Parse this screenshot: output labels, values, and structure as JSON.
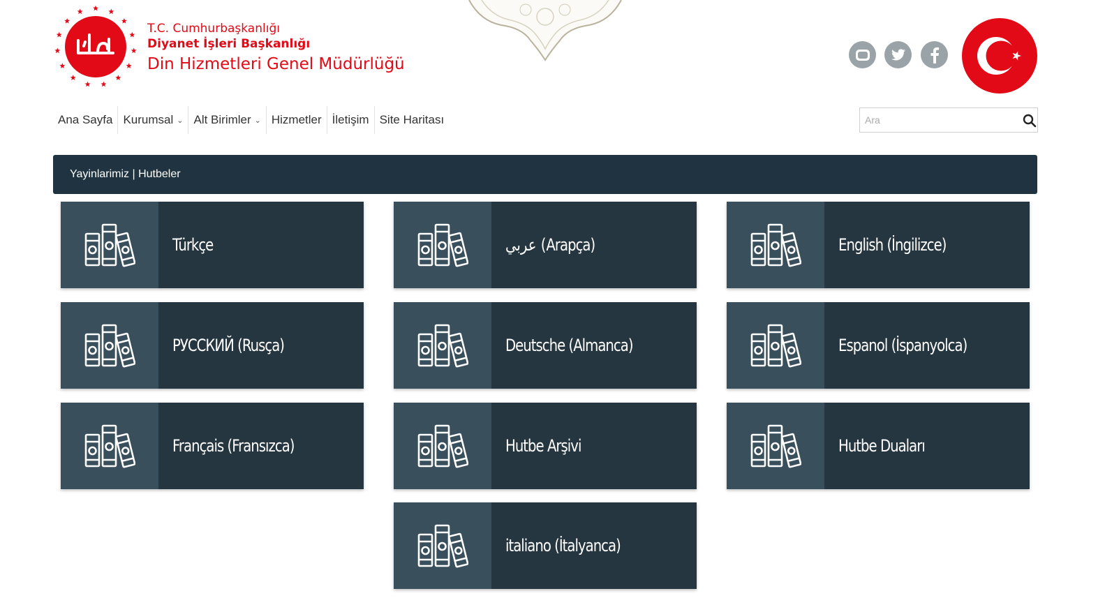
{
  "header": {
    "line1": "T.C. Cumhurbaşkanlığı",
    "line2": "Diyanet İşleri Başkanlığı",
    "line3": "Din Hizmetleri Genel Müdürlüğü",
    "logo_icon": "diyanet-logo-icon",
    "flag_icon": "turkish-flag-icon",
    "social": [
      "youtube-icon",
      "twitter-icon",
      "facebook-icon"
    ]
  },
  "colors": {
    "brand_red": "#e30a17",
    "dark_navy": "#1f3440",
    "card_icon_bg": "#394f5c",
    "card_label_bg": "#253640"
  },
  "nav": {
    "items": [
      {
        "label": "Ana Sayfa",
        "has_dropdown": false
      },
      {
        "label": "Kurumsal",
        "has_dropdown": true
      },
      {
        "label": "Alt Birimler",
        "has_dropdown": true
      },
      {
        "label": "Hizmetler",
        "has_dropdown": false
      },
      {
        "label": "İletişim",
        "has_dropdown": false
      },
      {
        "label": "Site Haritası",
        "has_dropdown": false
      }
    ],
    "dropdown_glyph": "⌄"
  },
  "search": {
    "placeholder": "Ara",
    "value": ""
  },
  "breadcrumb": "Yayinlarimiz | Hutbeler",
  "cards": [
    {
      "label": "Türkçe",
      "icon": "books-icon"
    },
    {
      "label": "عربي (Arapça)",
      "icon": "books-icon"
    },
    {
      "label": "English (İngilizce)",
      "icon": "books-icon"
    },
    {
      "label": "РУССКИЙ (Rusça)",
      "icon": "books-icon"
    },
    {
      "label": "Deutsche (Almanca)",
      "icon": "books-icon"
    },
    {
      "label": "Espanol (İspanyolca)",
      "icon": "books-icon"
    },
    {
      "label": "Français (Fransızca)",
      "icon": "books-icon"
    },
    {
      "label": "Hutbe Arşivi",
      "icon": "books-icon"
    },
    {
      "label": "Hutbe Duaları",
      "icon": "books-icon"
    },
    {
      "label": "italiano (İtalyanca)",
      "icon": "books-icon"
    }
  ]
}
